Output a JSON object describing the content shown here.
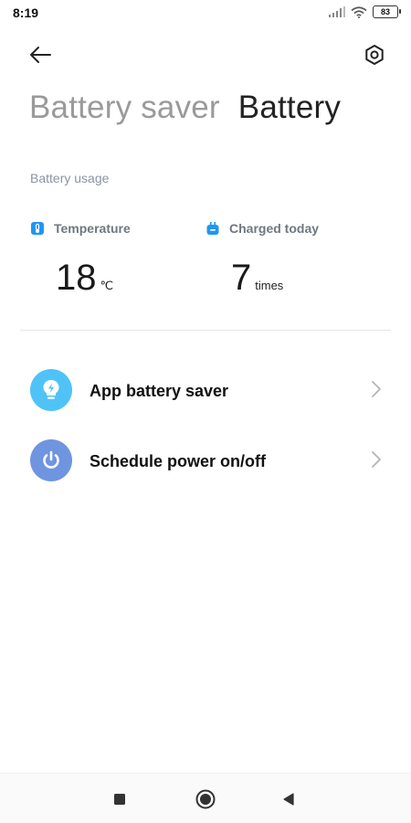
{
  "status_bar": {
    "time": "8:19",
    "battery_level": "83"
  },
  "header": {
    "back_icon": "arrow-left-icon",
    "settings_icon": "gear-icon"
  },
  "tabs": [
    {
      "label": "Battery saver",
      "active": false
    },
    {
      "label": "Battery",
      "active": true
    }
  ],
  "section_label": "Battery usage",
  "stats": {
    "temperature": {
      "label": "Temperature",
      "value": "18",
      "unit": "℃",
      "icon": "thermometer-icon"
    },
    "charged_today": {
      "label": "Charged today",
      "value": "7",
      "unit": "times",
      "icon": "plug-icon"
    }
  },
  "menu": [
    {
      "title": "App battery saver",
      "icon": "lightbulb-bolt-icon",
      "color": "#4fc3f7"
    },
    {
      "title": "Schedule power on/off",
      "icon": "power-icon",
      "color": "#6f95e0"
    }
  ],
  "colors": {
    "accent_blue": "#2196f3",
    "inactive_tab": "#9a9a9a"
  }
}
